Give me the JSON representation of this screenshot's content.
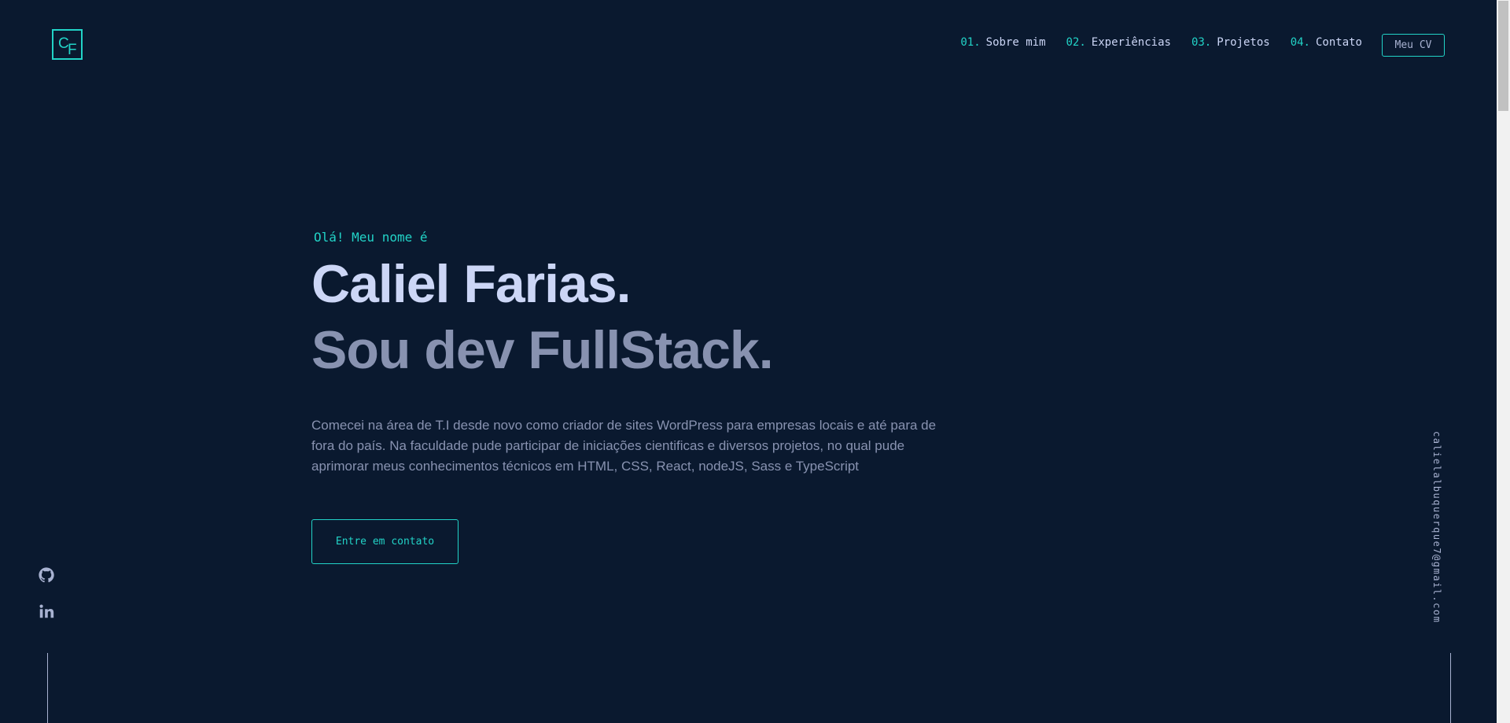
{
  "logo": {
    "c": "C",
    "f": "F"
  },
  "nav": {
    "items": [
      {
        "num": "01.",
        "label": "Sobre mim"
      },
      {
        "num": "02.",
        "label": "Experiências"
      },
      {
        "num": "03.",
        "label": "Projetos"
      },
      {
        "num": "04.",
        "label": "Contato"
      }
    ],
    "cv_label": "Meu CV"
  },
  "hero": {
    "greeting": "Olá! Meu nome é",
    "name": "Caliel Farias.",
    "role": "Sou dev FullStack.",
    "bio": "Comecei na área de T.I desde novo como criador de sites WordPress para empresas locais e até para de fora do país. Na faculdade pude participar de iniciações cientificas e diversos projetos, no qual pude aprimorar meus conhecimentos técnicos em HTML, CSS, React, nodeJS, Sass e TypeScript",
    "cta_label": "Entre em contato"
  },
  "social": {
    "icons": [
      "github-icon",
      "linkedin-icon"
    ]
  },
  "email": "calielalbuquerque7@gmail.com",
  "colors": {
    "background": "#0a192f",
    "accent": "#22d3c7",
    "heading": "#ccd6f6",
    "muted": "#8892b0"
  }
}
